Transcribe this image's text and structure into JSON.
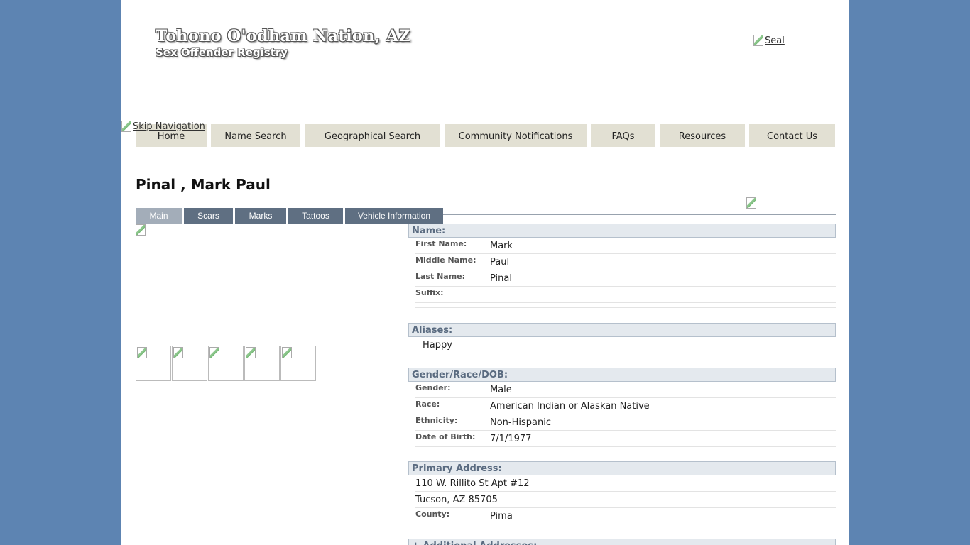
{
  "header": {
    "title": "Tohono O'odham Nation, AZ",
    "subtitle": "Sex Offender Registry",
    "seal_alt": "Seal",
    "skip_nav_alt": "Skip Navigation"
  },
  "nav": {
    "items": [
      {
        "label": "Home"
      },
      {
        "label": "Name Search"
      },
      {
        "label": "Geographical Search"
      },
      {
        "label": "Community Notifications"
      },
      {
        "label": "FAQs"
      },
      {
        "label": "Resources"
      },
      {
        "label": "Contact Us"
      }
    ]
  },
  "person": {
    "display_name": "Pinal , Mark Paul"
  },
  "tabs": [
    {
      "label": "Main",
      "active": true
    },
    {
      "label": "Scars"
    },
    {
      "label": "Marks"
    },
    {
      "label": "Tattoos"
    },
    {
      "label": "Vehicle Information"
    }
  ],
  "sections": {
    "name": {
      "heading": "Name:",
      "first_label": "First Name:",
      "first": "Mark",
      "middle_label": "Middle Name:",
      "middle": "Paul",
      "last_label": "Last Name:",
      "last": "Pinal",
      "suffix_label": "Suffix:",
      "suffix": ""
    },
    "aliases": {
      "heading": "Aliases:",
      "items": [
        "Happy"
      ]
    },
    "gender_race_dob": {
      "heading": "Gender/Race/DOB:",
      "gender_label": "Gender:",
      "gender": "Male",
      "race_label": "Race:",
      "race": "American Indian or Alaskan Native",
      "ethnicity_label": "Ethnicity:",
      "ethnicity": "Non-Hispanic",
      "dob_label": "Date of Birth:",
      "dob": "7/1/1977"
    },
    "primary_address": {
      "heading": "Primary Address:",
      "line1": "110 W. Rillito St Apt #12",
      "line2": "Tucson, AZ 85705",
      "county_label": "County:",
      "county": "Pima"
    },
    "additional_addresses": {
      "heading": "+ Additional Addresses:"
    }
  }
}
